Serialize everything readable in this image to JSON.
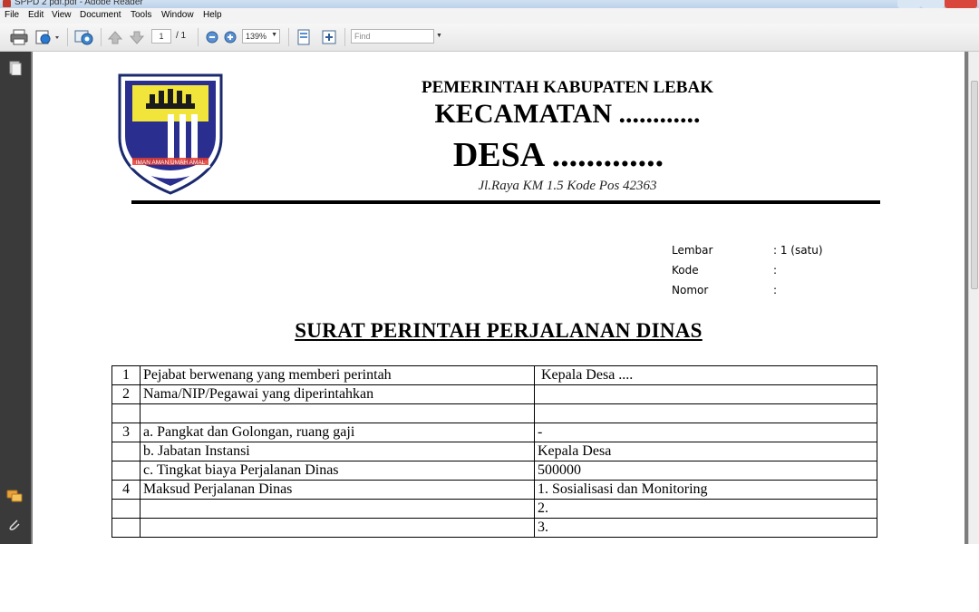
{
  "window": {
    "title": "SPPD 2 pdf.pdf - Adobe Reader"
  },
  "menu": [
    "File",
    "Edit",
    "View",
    "Document",
    "Tools",
    "Window",
    "Help"
  ],
  "toolbar": {
    "page_current": "1",
    "page_total": "/ 1",
    "zoom": "139%",
    "find_placeholder": "Find"
  },
  "document": {
    "header": {
      "line1": "PEMERINTAH KABUPATEN LEBAK",
      "line2": "KECAMATAN ............",
      "line3": "DESA .............",
      "address": "Jl.Raya KM 1.5 Kode Pos 42363",
      "logo_motto": "IMAN AMAN UMAH AMAL"
    },
    "meta": [
      {
        "label": "Lembar",
        "value": ": 1 (satu)"
      },
      {
        "label": "Kode",
        "value": ":"
      },
      {
        "label": "Nomor",
        "value": ":"
      }
    ],
    "title": "SURAT PERINTAH PERJALANAN DINAS",
    "table": [
      {
        "no": "1",
        "desc": "Pejabat berwenang yang memberi perintah",
        "value": " Kepala Desa ...."
      },
      {
        "no": "2",
        "desc": "Nama/NIP/Pegawai yang diperintahkan",
        "value": ""
      },
      {
        "no": "",
        "desc": "",
        "value": ""
      },
      {
        "no": "3",
        "desc": "a. Pangkat dan Golongan, ruang gaji",
        "value": "-"
      },
      {
        "no": "",
        "desc": "b. Jabatan Instansi",
        "value": "Kepala Desa"
      },
      {
        "no": "",
        "desc": "c. Tingkat biaya Perjalanan Dinas",
        "value": "500000"
      },
      {
        "no": "4",
        "desc": "Maksud Perjalanan Dinas",
        "value": "1. Sosialisasi dan Monitoring"
      },
      {
        "no": "",
        "desc": "",
        "value": "2."
      },
      {
        "no": "",
        "desc": "",
        "value": "3."
      }
    ]
  }
}
